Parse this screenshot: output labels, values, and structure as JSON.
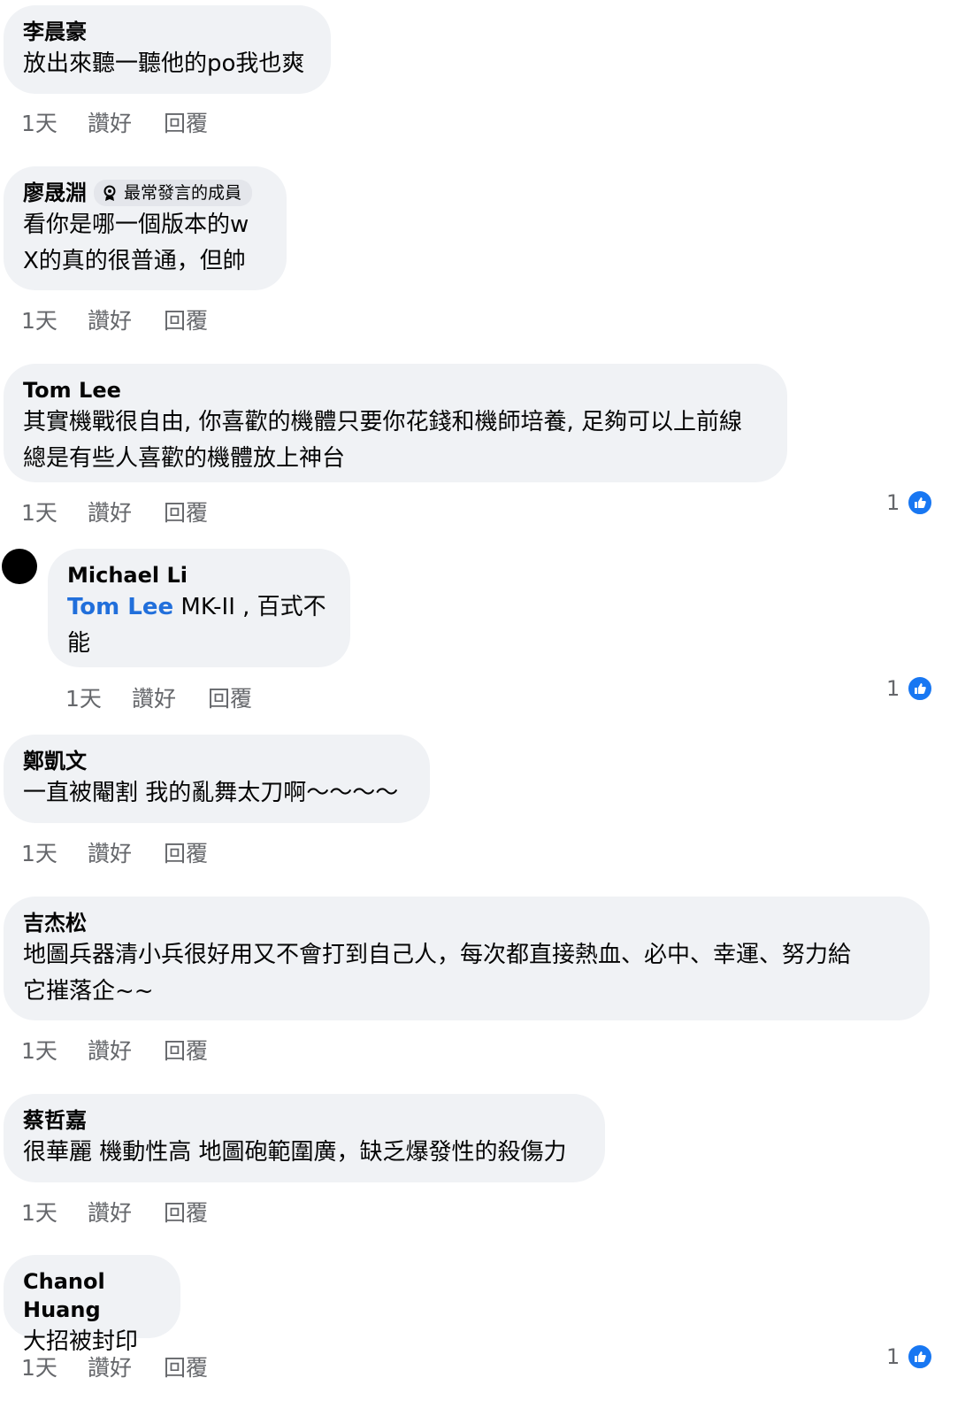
{
  "comments": [
    {
      "author": "李晨豪",
      "text": "放出來聽一聽他的po我也爽",
      "time": "1天",
      "like": "讚好",
      "reply": "回覆"
    },
    {
      "author": "廖晟淵",
      "badge": "最常發言的成員",
      "text": "看你是哪一個版本的w\nX的真的很普通，但帥",
      "time": "1天",
      "like": "讚好",
      "reply": "回覆"
    },
    {
      "author": "Tom Lee",
      "text": "其實機戰很自由, 你喜歡的機體只要你花錢和機師培養, 足夠可以上前線\n總是有些人喜歡的機體放上神台",
      "time": "1天",
      "like": "讚好",
      "reply": "回覆",
      "reactions": "1"
    },
    {
      "author": "Michael Li",
      "mention": "Tom Lee",
      "text": " MK-II , 百式不\n能",
      "time": "1天",
      "like": "讚好",
      "reply": "回覆",
      "reactions": "1"
    },
    {
      "author": "鄭凱文",
      "text": "一直被閹割 我的亂舞太刀啊～～～～",
      "time": "1天",
      "like": "讚好",
      "reply": "回覆"
    },
    {
      "author": "吉杰松",
      "text": "地圖兵器清小兵很好用又不會打到自己人，每次都直接熱血、必中、幸運、努力給\n它摧落企~~",
      "time": "1天",
      "like": "讚好",
      "reply": "回覆"
    },
    {
      "author": "蔡哲嘉",
      "text": "很華麗 機動性高 地圖砲範圍廣，缺乏爆發性的殺傷力",
      "time": "1天",
      "like": "讚好",
      "reply": "回覆"
    },
    {
      "author": "Chanol Huang",
      "text": "大招被封印",
      "time": "1天",
      "like": "讚好",
      "reply": "回覆",
      "reactions": "1"
    }
  ],
  "colors": {
    "bubble": "#f0f2f5",
    "meta": "#65676b",
    "like_blue": "#1877f2",
    "mention": "#216fdb"
  },
  "icons": {
    "badge": "member-badge-icon",
    "reaction": "like-reaction-icon",
    "avatar": "avatar"
  }
}
